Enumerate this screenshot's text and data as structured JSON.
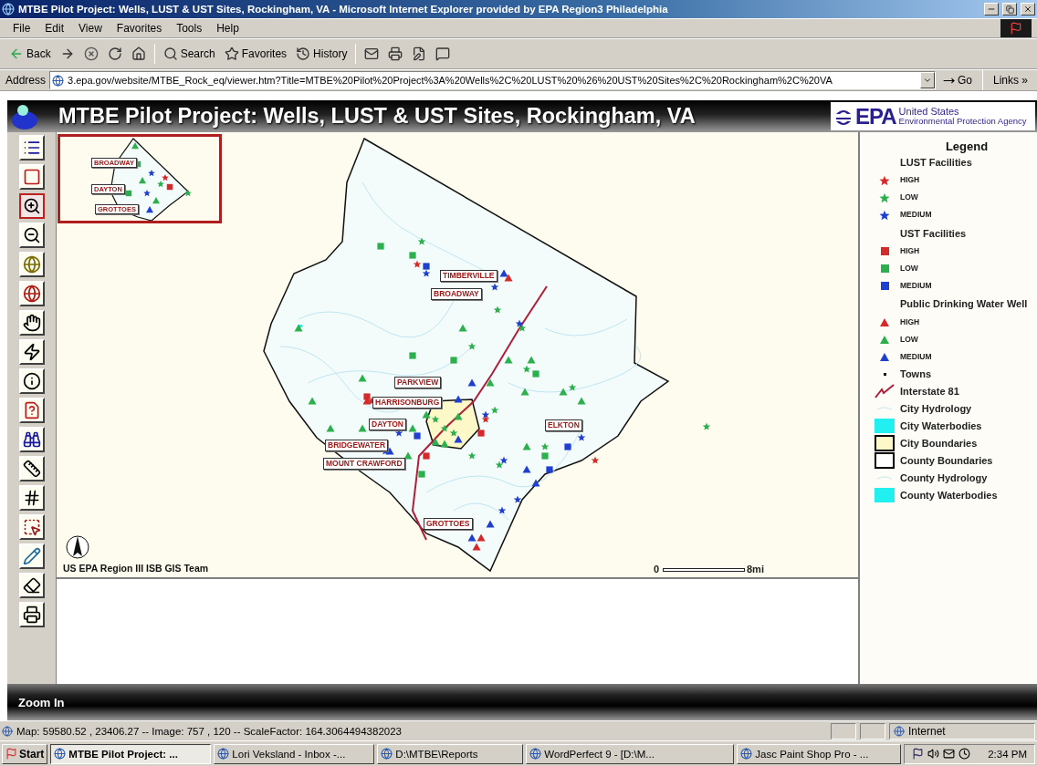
{
  "window": {
    "title": "MTBE Pilot Project: Wells, LUST & UST Sites, Rockingham, VA - Microsoft Internet Explorer provided by EPA Region3 Philadelphia"
  },
  "menu": [
    "File",
    "Edit",
    "View",
    "Favorites",
    "Tools",
    "Help"
  ],
  "toolbar": [
    {
      "kind": "back",
      "label": "Back"
    },
    {
      "kind": "forward"
    },
    {
      "kind": "stop"
    },
    {
      "kind": "refresh"
    },
    {
      "kind": "home"
    },
    {
      "kind": "search",
      "label": "Search"
    },
    {
      "kind": "favorites",
      "label": "Favorites"
    },
    {
      "kind": "history",
      "label": "History"
    },
    {
      "kind": "mail"
    },
    {
      "kind": "print"
    },
    {
      "kind": "edit"
    },
    {
      "kind": "discuss"
    }
  ],
  "address": {
    "label": "Address",
    "value": "3.epa.gov/website/MTBE_Rock_eq/viewer.htm?Title=MTBE%20Pilot%20Project%3A%20Wells%2C%20LUST%20%26%20UST%20Sites%2C%20Rockingham%2C%20VA",
    "go": "Go",
    "links": "Links »"
  },
  "header": {
    "title": "MTBE Pilot Project: Wells, LUST & UST Sites, Rockingham, VA",
    "agency_mark": "EPA",
    "agency_line_1": "United States",
    "agency_line_2": "Environmental Protection Agency"
  },
  "tools": [
    {
      "kind": "legend",
      "selected": false
    },
    {
      "kind": "overview",
      "selected": false
    },
    {
      "kind": "zoom_in",
      "selected": true
    },
    {
      "kind": "zoom_out",
      "selected": false
    },
    {
      "kind": "full_extent",
      "selected": false
    },
    {
      "kind": "active_extent",
      "selected": false
    },
    {
      "kind": "pan",
      "selected": false
    },
    {
      "kind": "hyperlink",
      "selected": false
    },
    {
      "kind": "identify",
      "selected": false
    },
    {
      "kind": "query",
      "selected": false
    },
    {
      "kind": "find",
      "selected": false
    },
    {
      "kind": "measure",
      "selected": false
    },
    {
      "kind": "buffer",
      "selected": false
    },
    {
      "kind": "select_rect",
      "selected": false
    },
    {
      "kind": "select_line",
      "selected": false
    },
    {
      "kind": "clear",
      "selected": false
    },
    {
      "kind": "print",
      "selected": false
    }
  ],
  "overview": {
    "towns": [
      "BROADWAY",
      "DAYTON",
      "GROTTOES"
    ]
  },
  "map": {
    "towns": [
      "TIMBERVILLE",
      "BROADWAY",
      "PARKVIEW",
      "HARRISONBURG",
      "DAYTON",
      "ELKTON",
      "BRIDGEWATER",
      "MOUNT CRAWFORD",
      "GROTTOES"
    ],
    "credit": "US EPA Region III ISB GIS Team",
    "scale_start": "0",
    "scale_end": "8mi"
  },
  "legend": {
    "title": "Legend",
    "items": [
      {
        "kind": "heading",
        "label": "LUST Facilities"
      },
      {
        "kind": "star",
        "color": "#d42a2a",
        "label": "HIGH"
      },
      {
        "kind": "star",
        "color": "#2cb04e",
        "label": "LOW"
      },
      {
        "kind": "star",
        "color": "#1f3fd0",
        "label": "MEDIUM"
      },
      {
        "kind": "heading",
        "label": "UST Facilities"
      },
      {
        "kind": "square",
        "color": "#d42a2a",
        "label": "HIGH"
      },
      {
        "kind": "square",
        "color": "#2cb04e",
        "label": "LOW"
      },
      {
        "kind": "square",
        "color": "#1f3fd0",
        "label": "MEDIUM"
      },
      {
        "kind": "heading",
        "label": "Public Drinking Water Well"
      },
      {
        "kind": "triangle",
        "color": "#d42a2a",
        "label": "HIGH"
      },
      {
        "kind": "triangle",
        "color": "#2cb04e",
        "label": "LOW"
      },
      {
        "kind": "triangle",
        "color": "#1f3fd0",
        "label": "MEDIUM"
      },
      {
        "kind": "dot",
        "label": "Towns"
      },
      {
        "kind": "line",
        "label": "Interstate 81"
      },
      {
        "kind": "hydro",
        "label": "City Hydrology"
      },
      {
        "kind": "fill",
        "color": "#22f0f0",
        "label": "City Waterbodies"
      },
      {
        "kind": "outline",
        "color": "#fdf8c8",
        "label": "City Boundaries"
      },
      {
        "kind": "outline",
        "color": "#ffffff",
        "label": "County Boundaries"
      },
      {
        "kind": "hydro",
        "label": "County Hydrology"
      },
      {
        "kind": "fill",
        "color": "#22f0f0",
        "label": "County Waterbodies"
      }
    ]
  },
  "mode": "Zoom In",
  "status": {
    "text": "Map: 59580.52 , 23406.27 -- Image: 757 , 120 -- ScaleFactor: 164.3064494382023",
    "zone": "Internet"
  },
  "taskbar": {
    "start": "Start",
    "tasks": [
      {
        "label": "MTBE Pilot Project: ...",
        "selected": true
      },
      {
        "label": "Lori Veksland - Inbox -...",
        "selected": false
      },
      {
        "label": "D:\\MTBE\\Reports",
        "selected": false
      },
      {
        "label": "WordPerfect 9 - [D:\\M...",
        "selected": false
      },
      {
        "label": "Jasc Paint Shop Pro - ...",
        "selected": false
      }
    ],
    "time": "2:34 PM"
  }
}
